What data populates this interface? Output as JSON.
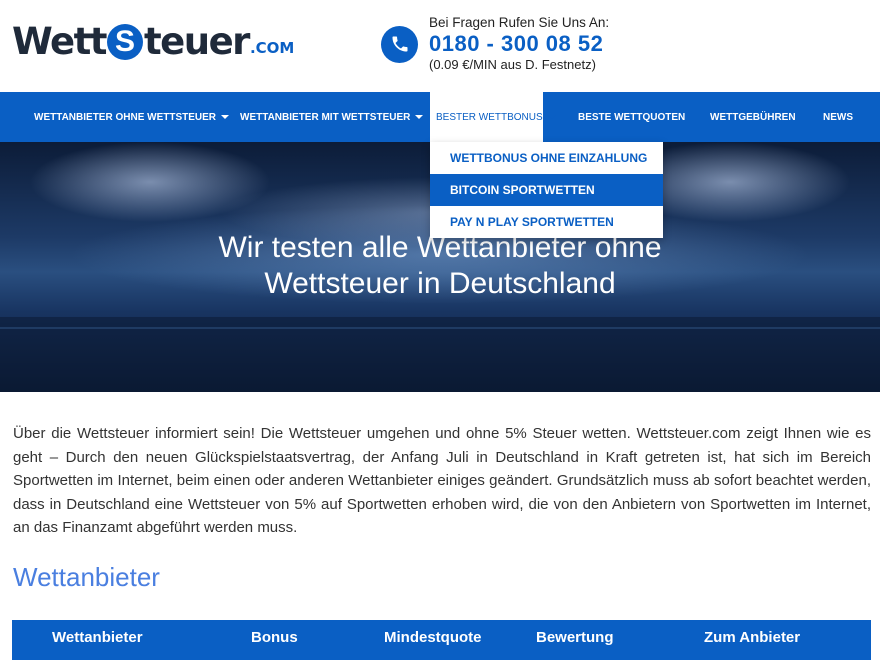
{
  "header": {
    "logo": {
      "part1": "Wett",
      "s": "S",
      "part2": "teuer",
      "suffix": ".COM"
    },
    "phone": {
      "label": "Bei Fragen Rufen Sie Uns An:",
      "number": "0180 - 300 08 52",
      "note": "(0.09 €/MIN aus D. Festnetz)",
      "icon": "phone-icon"
    }
  },
  "nav": {
    "items": [
      {
        "label": "Wettanbieter ohne Wettsteuer",
        "has_caret": true,
        "active": false
      },
      {
        "label": "Wettanbieter mit Wettsteuer",
        "has_caret": true,
        "active": false
      },
      {
        "label": "Bester Wettbonus",
        "has_caret": true,
        "active": true
      },
      {
        "label": "Beste Wettquoten",
        "has_caret": false,
        "active": false
      },
      {
        "label": "Wettgebühren",
        "has_caret": false,
        "active": false
      },
      {
        "label": "News",
        "has_caret": false,
        "active": false
      }
    ]
  },
  "dropdown": {
    "items": [
      {
        "label": "Wettbonus ohne Einzahlung",
        "highlighted": false
      },
      {
        "label": "Bitcoin Sportwetten",
        "highlighted": true
      },
      {
        "label": "Pay N Play Sportwetten",
        "highlighted": false
      }
    ]
  },
  "hero": {
    "line1": "Wir testen alle Wettanbieter ohne",
    "line2": "Wettsteuer in Deutschland"
  },
  "intro": "Über die Wettsteuer informiert sein! Die Wettsteuer umgehen und ohne 5% Steuer wetten. Wettsteuer.com zeigt Ihnen wie es geht – Durch den neuen Glückspielstaatsvertrag, der Anfang Juli in Deutschland in Kraft getreten ist, hat sich im Bereich Sportwetten im Internet, beim einen oder anderen Wettanbieter einiges geändert. Grundsätzlich muss ab sofort beachtet werden, dass in Deutschland eine Wettsteuer von 5% auf Sportwetten erhoben wird, die von den Anbietern von Sportwetten im Internet, an das Finanzamt abgeführt werden muss.",
  "section": {
    "heading": "Wettanbieter"
  },
  "table": {
    "headers": [
      "Wettanbieter",
      "Bonus",
      "Mindestquote",
      "Bewertung",
      "Zum Anbieter"
    ]
  },
  "colors": {
    "primary": "#0a5fc4",
    "heading": "#4a7fe0",
    "hero_dark": "#0c1c38"
  }
}
